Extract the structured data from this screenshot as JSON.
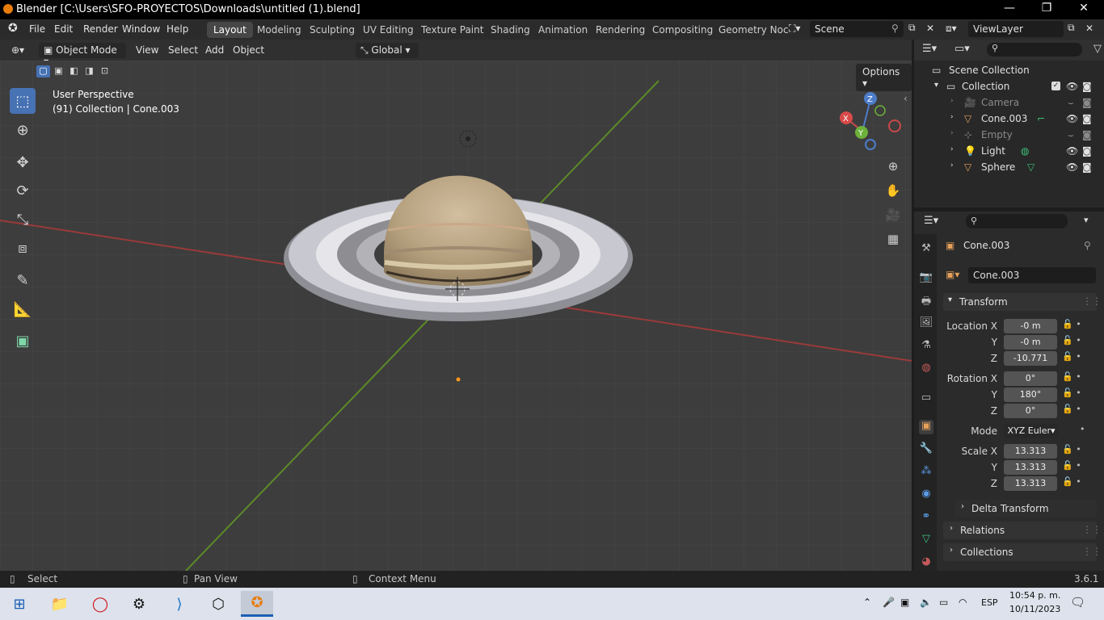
{
  "title_bar": {
    "title": "Blender [C:\\Users\\SFO-PROYECTOS\\Downloads\\untitled (1).blend]",
    "minimize": "—",
    "restore": "❐",
    "close": "✕"
  },
  "menu": [
    "File",
    "Edit",
    "Render",
    "Window",
    "Help"
  ],
  "workspaces": [
    "Layout",
    "Modeling",
    "Sculpting",
    "UV Editing",
    "Texture Paint",
    "Shading",
    "Animation",
    "Rendering",
    "Compositing",
    "Geometry Noc"
  ],
  "scene": "Scene",
  "view_layer": "ViewLayer",
  "viewport_header": {
    "mode": "Object Mode",
    "view": "View",
    "select": "Select",
    "add": "Add",
    "object": "Object",
    "orientation": "Global",
    "options": "Options"
  },
  "viewport": {
    "perspective": "User Perspective",
    "collection_info": "(91) Collection | Cone.003",
    "gizmo": {
      "z": "Z",
      "y": "Y",
      "x": "X"
    }
  },
  "outliner": {
    "scene_collection": "Scene Collection",
    "collection": "Collection",
    "items": [
      "Camera",
      "Cone.003",
      "Empty",
      "Light",
      "Sphere"
    ]
  },
  "properties": {
    "object_name": "Cone.003",
    "data_name": "Cone.003",
    "transform_label": "Transform",
    "location_label": "Location X",
    "y_label": "Y",
    "z_label": "Z",
    "location": [
      "-0 m",
      "-0 m",
      "-10.771"
    ],
    "rotation_label": "Rotation X",
    "rotation": [
      "0°",
      "180°",
      "0°"
    ],
    "mode_label": "Mode",
    "mode": "XYZ Euler",
    "scale_label": "Scale X",
    "scale": [
      "13.313",
      "13.313",
      "13.313"
    ],
    "delta_transform": "Delta Transform",
    "relations": "Relations",
    "collections": "Collections"
  },
  "status_bar": {
    "select": "Select",
    "pan_view": "Pan View",
    "context_menu": "Context Menu",
    "version": "3.6.1"
  },
  "taskbar": {
    "language": "ESP",
    "time": "10:54 p. m.",
    "date": "10/11/2023"
  },
  "colors": {
    "accent": "#4772b3",
    "viewport_bg": "#3d3d3d",
    "x_axis": "#b33c3c",
    "y_axis": "#6c9b2c"
  }
}
